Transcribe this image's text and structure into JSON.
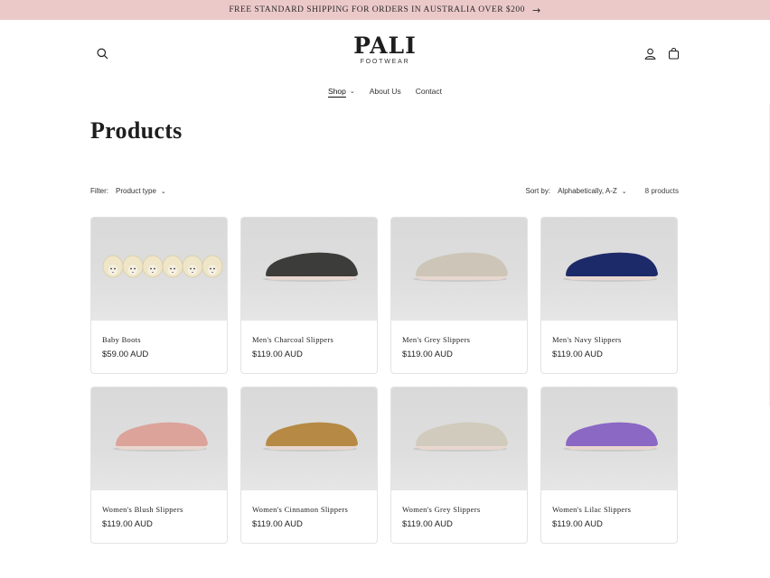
{
  "announcement": {
    "text": "FREE STANDARD SHIPPING FOR ORDERS IN AUSTRALIA OVER $200",
    "arrow": "→"
  },
  "header": {
    "brand": "PALI",
    "brand_sub": "FOOTWEAR",
    "icons": [
      "search-icon",
      "account-icon",
      "cart-icon"
    ]
  },
  "nav": {
    "items": [
      {
        "label": "Shop",
        "active": true,
        "dropdown": true
      },
      {
        "label": "About Us",
        "active": false,
        "dropdown": false
      },
      {
        "label": "Contact",
        "active": false,
        "dropdown": false
      }
    ]
  },
  "main": {
    "title": "Products",
    "filter_label": "Filter:",
    "filter_value": "Product type",
    "sort_label": "Sort by:",
    "sort_value": "Alphabetically, A-Z",
    "count": "8 products"
  },
  "products": [
    {
      "name": "Baby Boots",
      "price": "$59.00 AUD",
      "type": "boots",
      "color": "#efe6c9"
    },
    {
      "name": "Men's Charcoal Slippers",
      "price": "$119.00 AUD",
      "type": "slipper",
      "color": "#3c3c3a"
    },
    {
      "name": "Men's Grey Slippers",
      "price": "$119.00 AUD",
      "type": "slipper",
      "color": "#cdc6b8"
    },
    {
      "name": "Men's Navy Slippers",
      "price": "$119.00 AUD",
      "type": "slipper",
      "color": "#1d2a6a"
    },
    {
      "name": "Women's Blush Slippers",
      "price": "$119.00 AUD",
      "type": "slipper",
      "color": "#dca39b"
    },
    {
      "name": "Women's Cinnamon Slippers",
      "price": "$119.00 AUD",
      "type": "slipper",
      "color": "#b68a44"
    },
    {
      "name": "Women's Grey Slippers",
      "price": "$119.00 AUD",
      "type": "slipper",
      "color": "#d1cbbd"
    },
    {
      "name": "Women's Lilac Slippers",
      "price": "$119.00 AUD",
      "type": "slipper",
      "color": "#8a68c4"
    }
  ],
  "colors": {
    "announcement_bg": "#ecc9c9",
    "sole": "#e8d7cf"
  }
}
